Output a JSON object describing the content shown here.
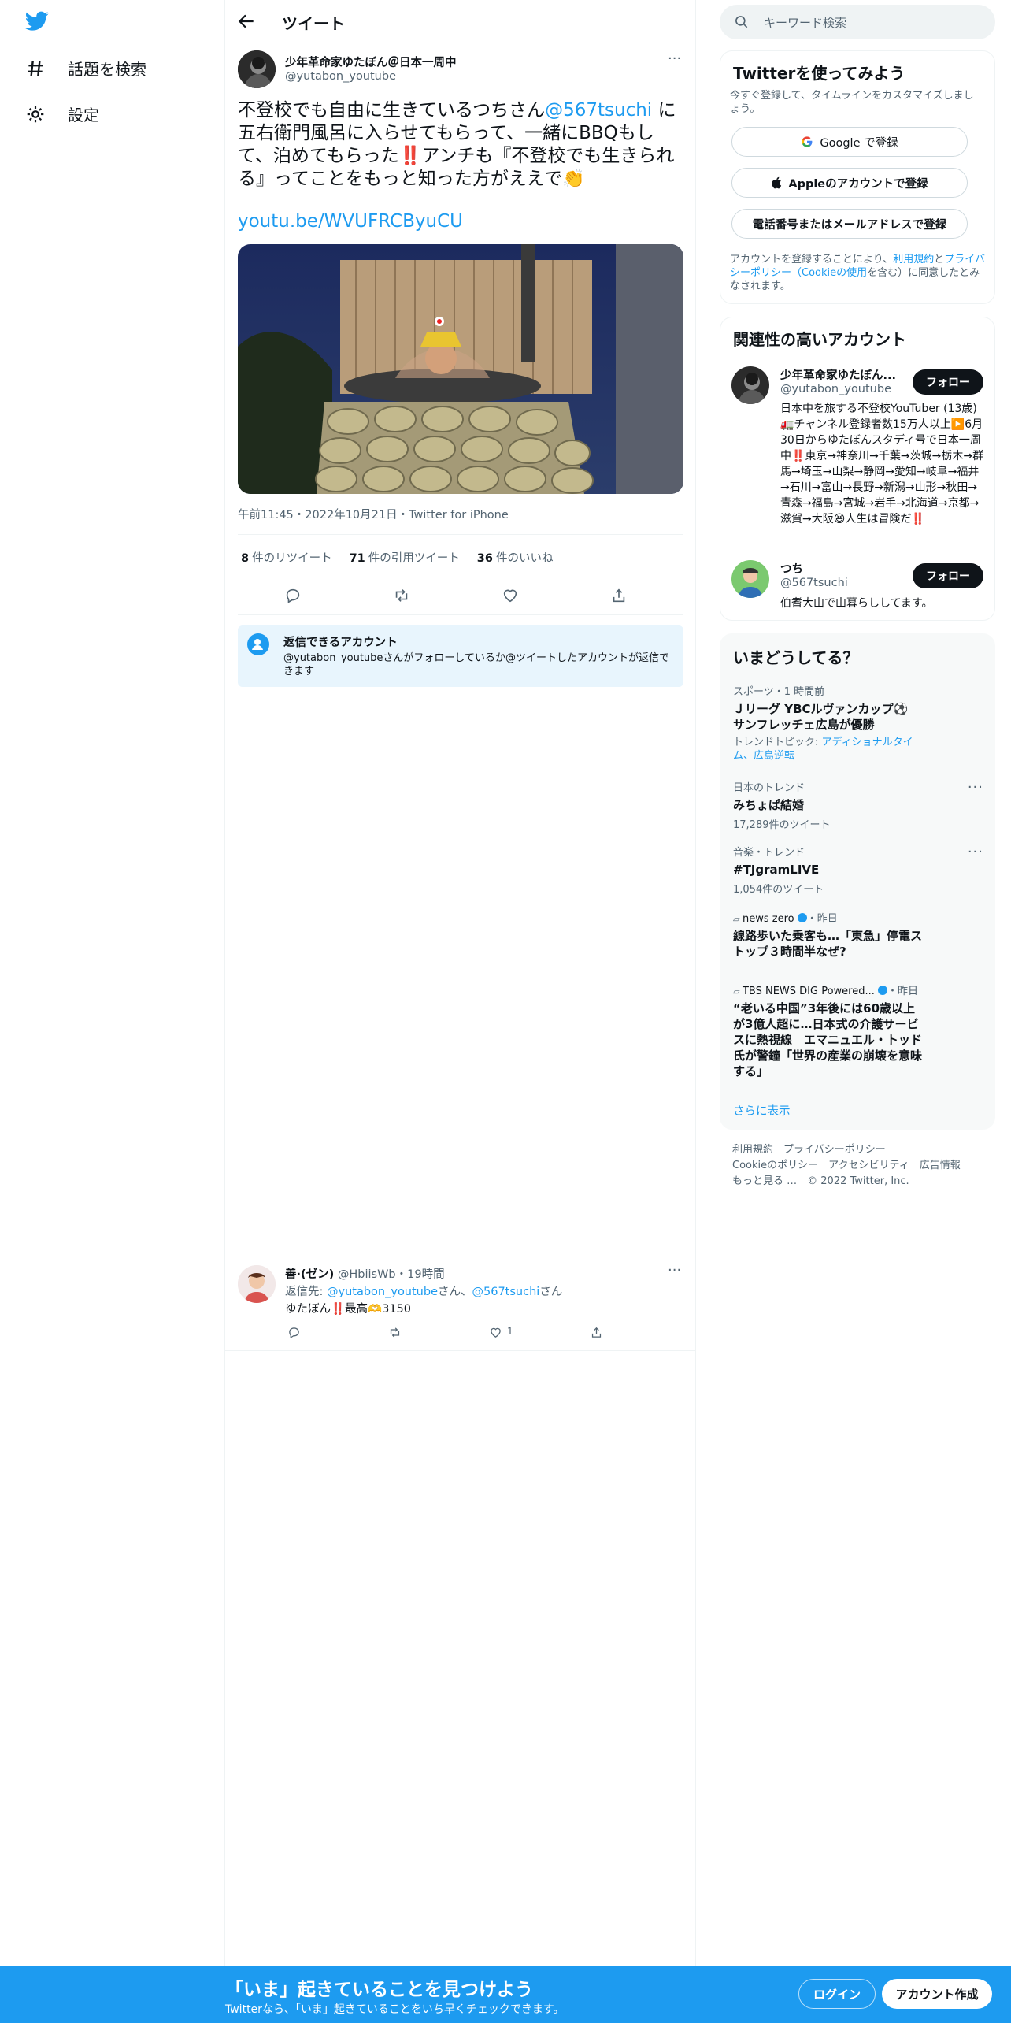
{
  "nav": {
    "explore_label": "話題を検索",
    "settings_label": "設定"
  },
  "header": {
    "title": "ツイート"
  },
  "tweet": {
    "author_name": "少年革命家ゆたぼん＠日本一周中",
    "author_handle": "@yutabon_youtube",
    "text_1": "不登校でも自由に生きているつちさん",
    "mention": "@567tsuchi",
    "text_2": " に五右衛門風呂に入らせてもらって、一緒にBBQもして、泊めてもらった‼️アンチも『不登校でも生きられる』ってことをもっと知った方がええで👏",
    "link": "youtu.be/WVUFRCByuCU",
    "meta": "午前11:45・2022年10月21日・Twitter for iPhone",
    "retweets_count": "8",
    "retweets_label": "件のリツイート",
    "quotes_count": "71",
    "quotes_label": "件の引用ツイート",
    "likes_count": "36",
    "likes_label": "件のいいね",
    "reply_title": "返信できるアカウント",
    "reply_desc": "@yutabon_youtubeさんがフォローしているか@ツイートしたアカウントが返信できます"
  },
  "reply": {
    "name": "善·(ゼン)",
    "handle": "@HbiisWb",
    "time": "・19時間",
    "to_prefix": "返信先: ",
    "to_1": "@yutabon_youtube",
    "to_mid": "さん、",
    "to_2": "@567tsuchi",
    "to_suffix": "さん",
    "text": "ゆたぼん‼️最高🫶3150",
    "likes": "1"
  },
  "search": {
    "placeholder": "キーワード検索"
  },
  "signup": {
    "title": "Twitterを使ってみよう",
    "desc": "今すぐ登録して、タイムラインをカスタマイズしましょう。",
    "google": "Google で登録",
    "apple": "Appleのアカウントで登録",
    "phone": "電話番号またはメールアドレスで登録",
    "terms_1": "アカウントを登録することにより、",
    "terms_link1": "利用規約",
    "terms_2": "と",
    "terms_link2": "プライバシーポリシー（Cookieの使用",
    "terms_3": "を含む）に同意したとみなされます。"
  },
  "related": {
    "title": "関連性の高いアカウント",
    "follow_label": "フォロー",
    "accounts": [
      {
        "name": "少年革命家ゆたぼん...",
        "handle": "@yutabon_youtube",
        "bio": "日本中を旅する不登校YouTuber (13歳) 🚛チャンネル登録者数15万人以上▶️6月30日からゆたぼんスタディ号で日本一周中‼️東京→神奈川→千葉→茨城→栃木→群馬→埼玉→山梨→静岡→愛知→岐阜→福井→石川→富山→長野→新潟→山形→秋田→青森→福島→宮城→岩手→北海道→京都→滋賀→大阪😆人生は冒険だ‼️"
      },
      {
        "name": "つち",
        "handle": "@567tsuchi",
        "bio": "伯耆大山で山暮らししてます。"
      }
    ]
  },
  "trends": {
    "title": "いまどうしてる？",
    "items": [
      {
        "category": "スポーツ・1 時間前",
        "title": "Ｊリーグ YBCルヴァンカップ⚽ サンフレッチェ広島が優勝",
        "sub_prefix": "トレンドトピック: ",
        "sub_links": "アディショナルタイム、広島逆転"
      },
      {
        "category": "日本のトレンド",
        "title": "みちょぱ結婚",
        "sub": "17,289件のツイート"
      },
      {
        "category": "音楽・トレンド",
        "title": "#TJgramLIVE",
        "sub": "1,054件のツイート"
      },
      {
        "category": "news zero",
        "category_suffix": "・昨日",
        "title": "線路歩いた乗客も…「東急」停電ストップ３時間半なぜ?"
      },
      {
        "category": "TBS NEWS DIG Powered...",
        "category_suffix": "・昨日",
        "title": "“老いる中国”3年後には60歳以上が3億人超に…日本式の介護サービスに熱視線　エマニュエル・トッド氏が警鐘「世界の産業の崩壊を意味する」"
      }
    ],
    "more": "さらに表示"
  },
  "footer": {
    "terms": "利用規約",
    "privacy": "プライバシーポリシー",
    "cookie": "Cookieのポリシー",
    "accessibility": "アクセシビリティ",
    "ads": "広告情報",
    "more": "もっと見る …",
    "copyright": "© 2022 Twitter, Inc."
  },
  "banner": {
    "title": "「いま」起きていることを見つけよう",
    "sub": "Twitterなら、「いま」起きていることをいち早くチェックできます。",
    "login": "ログイン",
    "signup": "アカウント作成"
  },
  "colors": {
    "accent": "#1d9bf0",
    "text": "#0f1419",
    "muted": "#536471"
  }
}
